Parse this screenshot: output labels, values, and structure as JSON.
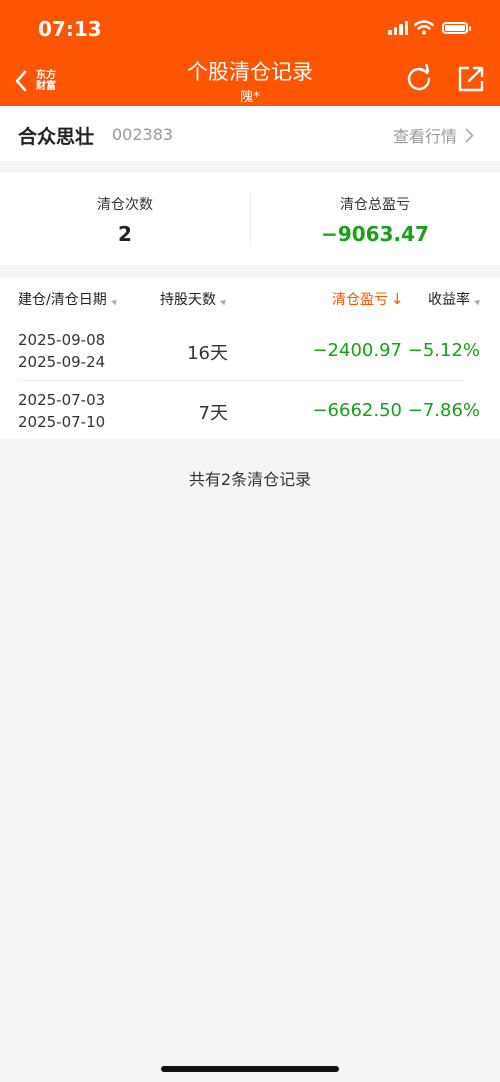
{
  "status_bar": {
    "time": "07:13"
  },
  "header": {
    "brand_line1": "东方",
    "brand_line2": "财富",
    "title": "个股清仓记录",
    "subtitle": "隗*"
  },
  "stock": {
    "name": "合众思壮",
    "code": "002383",
    "quote_label": "查看行情"
  },
  "summary": {
    "count_label": "清仓次数",
    "count_value": "2",
    "pnl_label": "清仓总盈亏",
    "pnl_value": "−9063.47"
  },
  "table": {
    "columns": [
      "建仓/清仓日期",
      "持股天数",
      "清仓盈亏",
      "收益率"
    ],
    "rows": [
      {
        "open_date": "2025-09-08",
        "close_date": "2025-09-24",
        "days": "16天",
        "pnl": "−2400.97",
        "return": "−5.12%"
      },
      {
        "open_date": "2025-07-03",
        "close_date": "2025-07-10",
        "days": "7天",
        "pnl": "−6662.50",
        "return": "−7.86%"
      }
    ]
  },
  "footer": {
    "count_text": "共有2条清仓记录"
  },
  "colors": {
    "brand": "#fe5504",
    "loss": "#17a117"
  }
}
